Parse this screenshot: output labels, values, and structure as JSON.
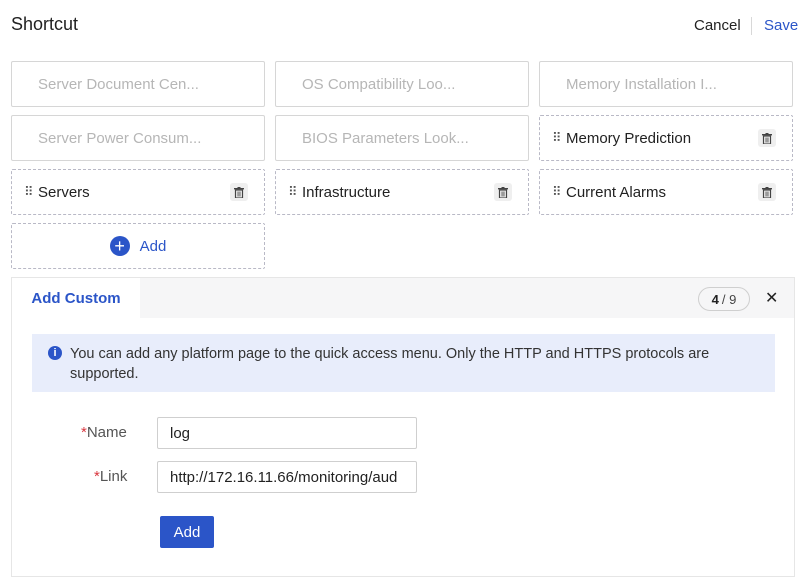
{
  "header": {
    "title": "Shortcut",
    "cancel_label": "Cancel",
    "save_label": "Save"
  },
  "shortcuts": [
    {
      "label": "Server Document Cen...",
      "state": "placeholder"
    },
    {
      "label": "OS Compatibility Loo...",
      "state": "placeholder"
    },
    {
      "label": "Memory Installation I...",
      "state": "placeholder"
    },
    {
      "label": "Server Power Consum...",
      "state": "placeholder"
    },
    {
      "label": "BIOS Parameters Look...",
      "state": "placeholder"
    },
    {
      "label": "Memory Prediction",
      "state": "added"
    },
    {
      "label": "Servers",
      "state": "added"
    },
    {
      "label": "Infrastructure",
      "state": "added"
    },
    {
      "label": "Current Alarms",
      "state": "added"
    }
  ],
  "add_tile": {
    "label": "Add"
  },
  "panel": {
    "tab_label": "Add Custom",
    "counter": {
      "current": "4",
      "separator": "/",
      "total": "9"
    },
    "notice": "You can add any platform page to the quick access menu. Only the HTTP and HTTPS protocols are supported.",
    "form": {
      "name_required_mark": "*",
      "name_label": "Name",
      "name_value": "log",
      "link_required_mark": "*",
      "link_label": "Link",
      "link_value": "http://172.16.11.66/monitoring/aud",
      "add_label": "Add"
    }
  },
  "colors": {
    "accent": "#2b55c8",
    "required": "#d9363e",
    "notice_bg": "#e8edfb"
  }
}
